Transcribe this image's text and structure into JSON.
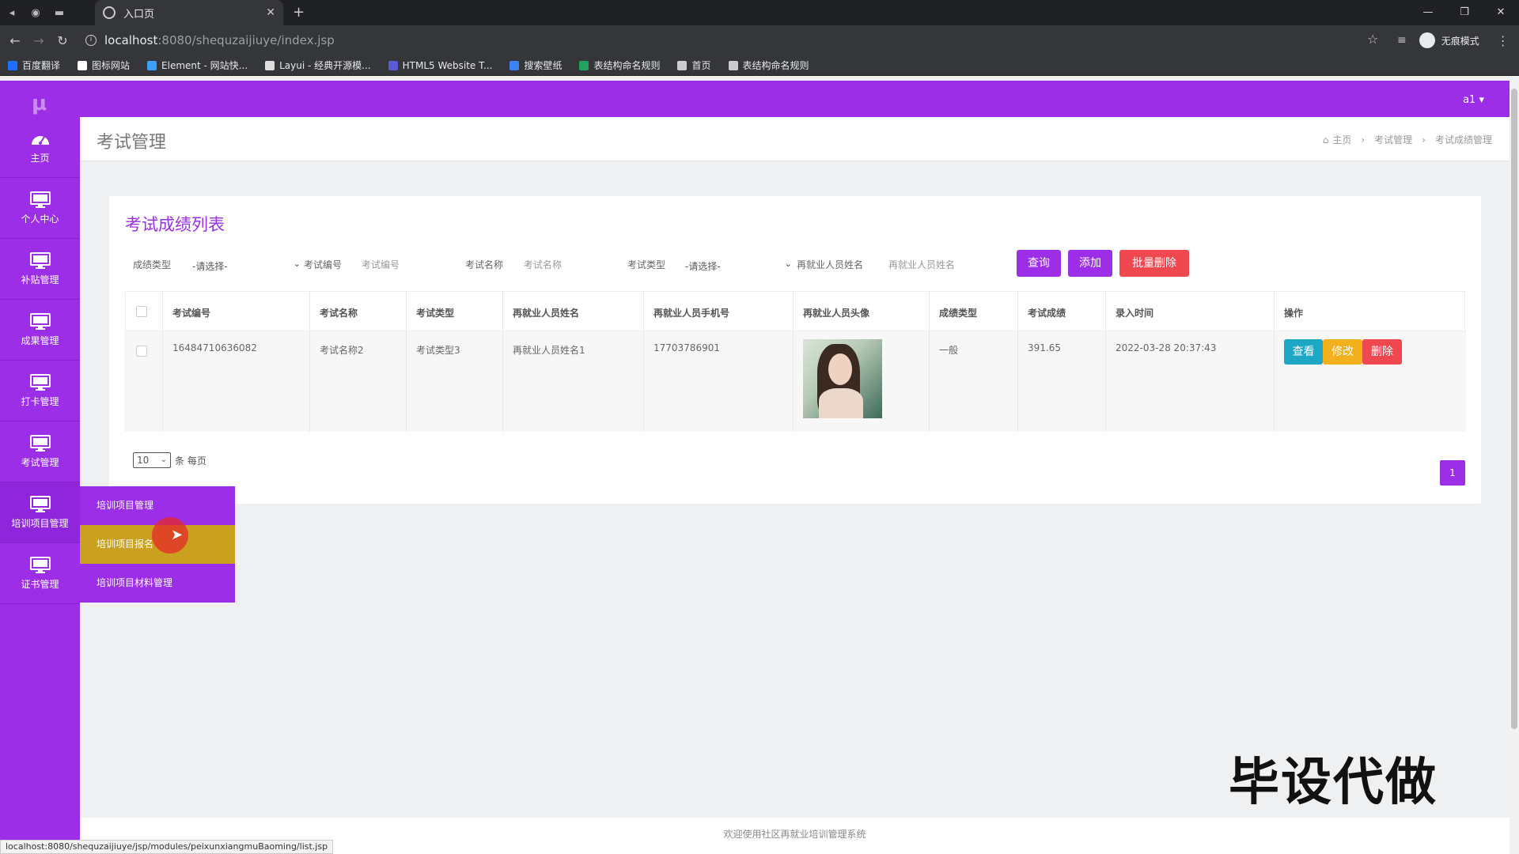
{
  "browser": {
    "tab_title": "入口页",
    "url_host": "localhost",
    "url_path": ":8080/shequzaijiuye/index.jsp",
    "incognito_label": "无痕模式",
    "bookmarks": [
      {
        "label": "百度翻译",
        "color": "#1e6fff"
      },
      {
        "label": "图标网站",
        "color": "#ffffff"
      },
      {
        "label": "Element - 网站快...",
        "color": "#409eff"
      },
      {
        "label": "Layui - 经典开源模...",
        "color": "#dddddd"
      },
      {
        "label": "HTML5 Website T...",
        "color": "#5b5bd6"
      },
      {
        "label": "搜索壁纸",
        "color": "#3b82f6"
      },
      {
        "label": "表结构命名规则",
        "color": "#21a35d"
      },
      {
        "label": "首页",
        "color": "#cccccc"
      },
      {
        "label": "表结构命名规则",
        "color": "#cccccc"
      }
    ],
    "status_url": "localhost:8080/shequzaijiuye/jsp/modules/peixunxiangmuBaoming/list.jsp"
  },
  "app": {
    "logo": "μ",
    "user": "a1 ▾",
    "accent": "#9b2ee6",
    "sidebar": [
      {
        "label": "主页",
        "icon": "dashboard-icon"
      },
      {
        "label": "个人中心",
        "icon": "monitor-icon"
      },
      {
        "label": "补贴管理",
        "icon": "monitor-icon"
      },
      {
        "label": "成果管理",
        "icon": "monitor-icon"
      },
      {
        "label": "打卡管理",
        "icon": "monitor-icon"
      },
      {
        "label": "考试管理",
        "icon": "monitor-icon"
      },
      {
        "label": "培训项目管理",
        "icon": "monitor-icon"
      },
      {
        "label": "证书管理",
        "icon": "monitor-icon"
      }
    ],
    "submenu": [
      {
        "label": "培训项目管理"
      },
      {
        "label": "培训项目报名"
      },
      {
        "label": "培训项目材料管理"
      }
    ],
    "page_title": "考试管理",
    "breadcrumb": [
      "主页",
      "考试管理",
      "考试成绩管理"
    ],
    "card_title": "考试成绩列表",
    "search": {
      "grade_type_label": "成绩类型",
      "grade_type_value": "-请选择-",
      "exam_no_label": "考试编号",
      "exam_no_placeholder": "考试编号",
      "exam_name_label": "考试名称",
      "exam_name_placeholder": "考试名称",
      "exam_type_label": "考试类型",
      "exam_type_value": "-请选择-",
      "person_name_label": "再就业人员姓名",
      "person_name_placeholder": "再就业人员姓名",
      "query_button": "查询",
      "add_button": "添加",
      "batch_delete_button": "批量删除"
    },
    "table": {
      "headers": [
        "考试编号",
        "考试名称",
        "考试类型",
        "再就业人员姓名",
        "再就业人员手机号",
        "再就业人员头像",
        "成绩类型",
        "考试成绩",
        "录入时间",
        "操作"
      ],
      "rows": [
        {
          "exam_no": "16484710636082",
          "exam_name": "考试名称2",
          "exam_type": "考试类型3",
          "person_name": "再就业人员姓名1",
          "phone": "17703786901",
          "grade_type": "一般",
          "score": "391.65",
          "entry_time": "2022-03-28 20:37:43"
        }
      ],
      "actions": {
        "view": "查看",
        "edit": "修改",
        "delete": "删除"
      }
    },
    "pagination": {
      "page_size": "10",
      "page_size_suffix": "条 每页",
      "current_page": "1"
    },
    "watermark": "毕设代做",
    "footer": "欢迎使用社区再就业培训管理系统"
  }
}
